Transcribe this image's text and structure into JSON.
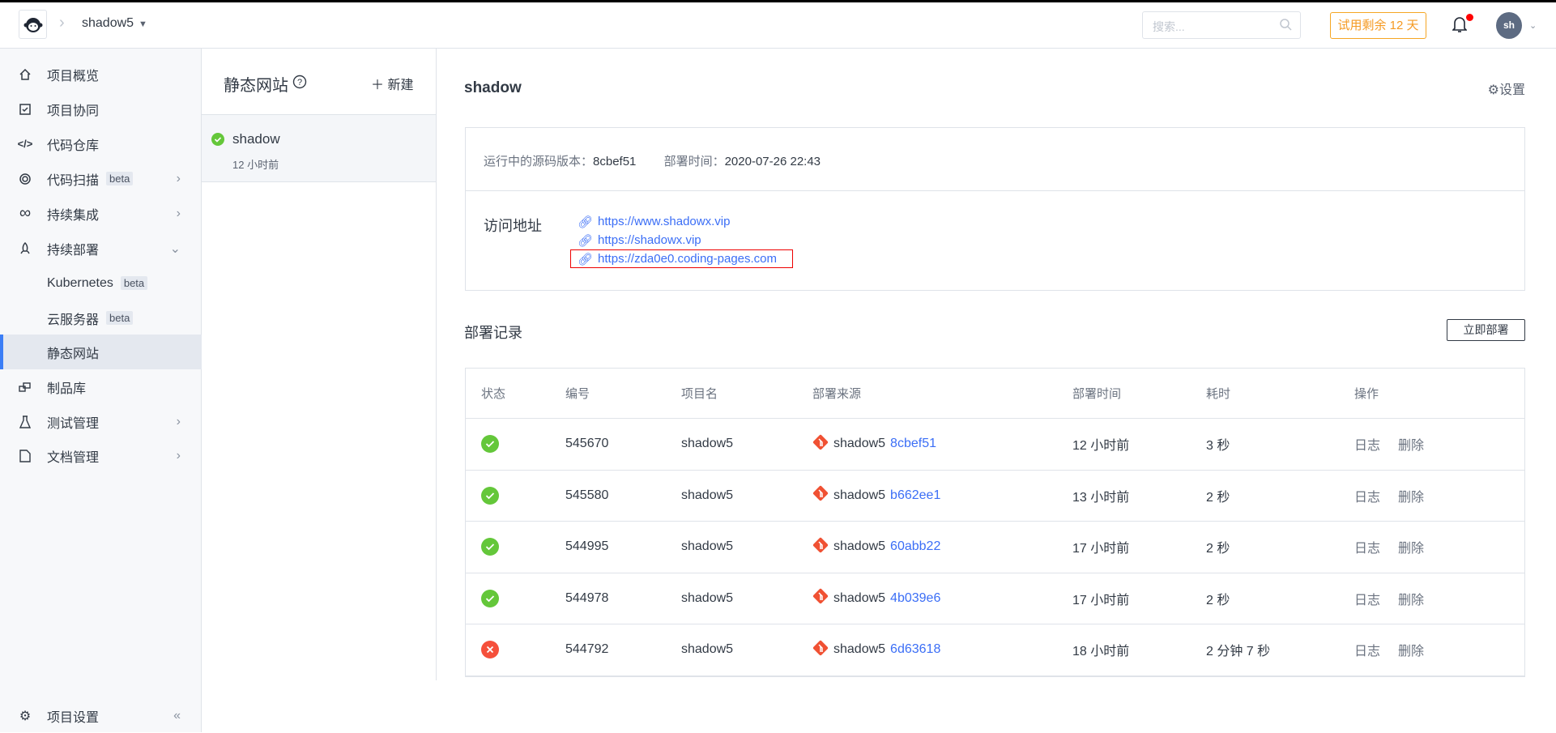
{
  "header": {
    "project": "shadow5",
    "search_placeholder": "搜索...",
    "trial": "试用剩余 12 天",
    "avatar": "sh"
  },
  "sidebar": {
    "items": [
      {
        "label": "项目概览",
        "icon": "home-icon"
      },
      {
        "label": "项目协同",
        "icon": "checkbox-icon"
      },
      {
        "label": "代码仓库",
        "icon": "code-icon"
      },
      {
        "label": "代码扫描",
        "icon": "scan-icon",
        "badge": "beta"
      },
      {
        "label": "持续集成",
        "icon": "infinity-icon"
      },
      {
        "label": "持续部署",
        "icon": "rocket-icon"
      },
      {
        "label": "Kubernetes",
        "badge": "beta"
      },
      {
        "label": "云服务器",
        "badge": "beta"
      },
      {
        "label": "静态网站"
      },
      {
        "label": "制品库",
        "icon": "artifact-icon"
      },
      {
        "label": "测试管理",
        "icon": "flask-icon"
      },
      {
        "label": "文档管理",
        "icon": "document-icon"
      }
    ],
    "settings": "项目设置"
  },
  "middle": {
    "title": "静态网站",
    "new": "新建",
    "item": {
      "name": "shadow",
      "time": "12 小时前"
    }
  },
  "main": {
    "title": "shadow",
    "settings": "设置",
    "version_label": "运行中的源码版本：",
    "version": "8cbef51",
    "time_label": "部署时间：",
    "time": "2020-07-26 22:43",
    "address_label": "访问地址",
    "links": [
      "https://www.shadowx.vip",
      "https://shadowx.vip",
      "https://zda0e0.coding-pages.com"
    ],
    "records_title": "部署记录",
    "deploy_now": "立即部署",
    "columns": [
      "状态",
      "编号",
      "项目名",
      "部署来源",
      "部署时间",
      "耗时",
      "操作"
    ],
    "rows": [
      {
        "status": "success",
        "id": "545670",
        "project": "shadow5",
        "source": "shadow5",
        "hash": "8cbef51",
        "time": "12 小时前",
        "duration": "3 秒"
      },
      {
        "status": "success",
        "id": "545580",
        "project": "shadow5",
        "source": "shadow5",
        "hash": "b662ee1",
        "time": "13 小时前",
        "duration": "2 秒"
      },
      {
        "status": "success",
        "id": "544995",
        "project": "shadow5",
        "source": "shadow5",
        "hash": "60abb22",
        "time": "17 小时前",
        "duration": "2 秒"
      },
      {
        "status": "success",
        "id": "544978",
        "project": "shadow5",
        "source": "shadow5",
        "hash": "4b039e6",
        "time": "17 小时前",
        "duration": "2 秒"
      },
      {
        "status": "failed",
        "id": "544792",
        "project": "shadow5",
        "source": "shadow5",
        "hash": "6d63618",
        "time": "18 小时前",
        "duration": "2 分钟 7 秒"
      }
    ],
    "actions": {
      "log": "日志",
      "delete": "删除"
    }
  }
}
